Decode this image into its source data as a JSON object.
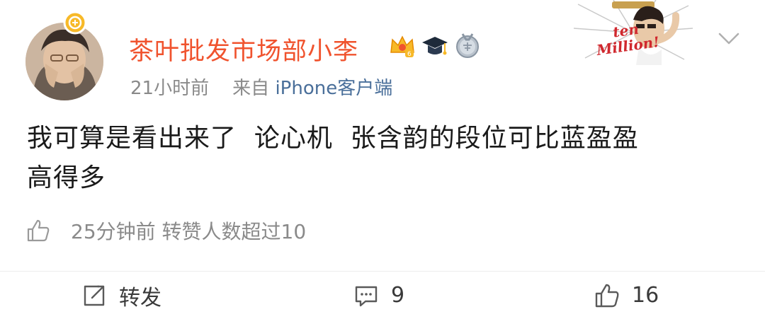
{
  "post": {
    "username": "茶叶批发市场部小李",
    "time": "21小时前",
    "source_prefix": "来自",
    "source_client": "iPhone客户端",
    "content_line1": "我可算是看出来了  论心机  张含韵的段位可比蓝盈盈",
    "content_line2": "高得多",
    "badges": [
      "crown-icon",
      "graduation-cap-icon",
      "medal-icon"
    ],
    "decoration_text": "ten Million!"
  },
  "reply_hint": {
    "text": "25分钟前 转赞人数超过10"
  },
  "actions": {
    "repost_label": "转发",
    "comment_count": "9",
    "like_count": "16"
  },
  "colors": {
    "username": "#f0532e",
    "client_link": "#4a6f9a",
    "meta": "#8a8a8a",
    "text": "#1a1a1a"
  }
}
